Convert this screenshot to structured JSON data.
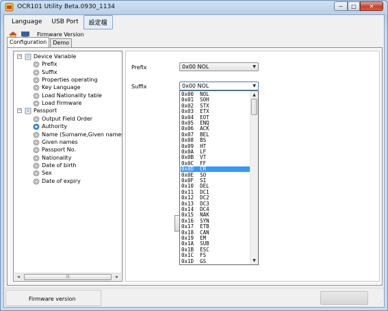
{
  "window": {
    "title": "OCR101 Utility Beta.0930_1134",
    "caption": {
      "minimize": "─",
      "maximize": "□",
      "close": "✕"
    }
  },
  "menubar": {
    "items": [
      "Language",
      "USB Port",
      "設定檔"
    ]
  },
  "toolbar": {
    "label": "Firmware Version",
    "icons": [
      "home-icon",
      "note-icon"
    ]
  },
  "tabs": [
    "Configuration",
    "Demo"
  ],
  "tree": {
    "groups": [
      {
        "label": "Device Variable",
        "toggle": "−",
        "children": [
          "Prefix",
          "Suffix",
          "Properties operating",
          "Key Language",
          "Load Nationality table",
          "Load Firmware"
        ]
      },
      {
        "label": "Passport",
        "toggle": "−",
        "children": [
          "Output Field Order",
          "Authority",
          "Name (Surname,Given names)",
          "Given names",
          "Passport No.",
          "Nationality",
          "Date of birth",
          "Sex",
          "Date of expiry"
        ]
      }
    ],
    "selected_child": "Authority",
    "hscroll": {
      "left": "◂",
      "right": "▸",
      "grip": "III"
    }
  },
  "settings": {
    "prefix": {
      "label": "Prefix",
      "value": "0x00  NOL"
    },
    "suffix": {
      "label": "Suffix",
      "value": "0x00  NOL"
    },
    "dropdown_arrow": "▼"
  },
  "dropdown": {
    "scroll_up": "▲",
    "scroll_down": "▼",
    "selected": "0x0D  CR",
    "options": [
      "0x00  NOL",
      "0x01  SOH",
      "0x02  STX",
      "0x03  ETX",
      "0x04  EOT",
      "0x05  ENQ",
      "0x06  ACK",
      "0x07  BEL",
      "0x08  BS",
      "0x09  HT",
      "0x0A  LF",
      "0x0B  VT",
      "0x0C  FF",
      "0x0D  CR",
      "0x0E  SO",
      "0x0F  SI",
      "0x10  DEL",
      "0x11  DC1",
      "0x12  DC2",
      "0x13  DC3",
      "0x14  DC4",
      "0x15  NAK",
      "0x16  SYN",
      "0x17  ETB",
      "0x18  CAN",
      "0x19  EM",
      "0x1A  SUB",
      "0x1B  ESC",
      "0x1C  FS",
      "0x1D  GS"
    ]
  },
  "statusbar": {
    "text": "Firmware version"
  }
}
